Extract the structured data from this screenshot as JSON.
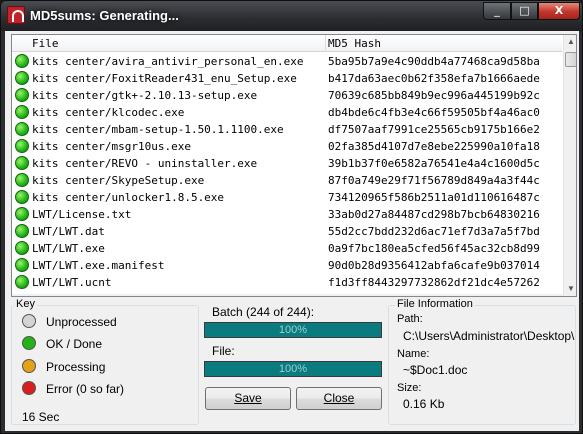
{
  "window": {
    "title": "MD5sums: Generating...",
    "min": "_",
    "max": "□",
    "close": "X"
  },
  "list": {
    "col_file": "File",
    "col_hash": "MD5 Hash",
    "rows": [
      {
        "file": "kits center/avira_antivir_personal_en.exe",
        "hash": "5ba95b7a9e4c90ddb4a77468ca9d58ba"
      },
      {
        "file": "kits center/FoxitReader431_enu_Setup.exe",
        "hash": "b417da63aec0b62f358efa7b1666aede"
      },
      {
        "file": "kits center/gtk+-2.10.13-setup.exe",
        "hash": "70639c685bb849b9ec996a445199b92c"
      },
      {
        "file": "kits center/klcodec.exe",
        "hash": "db4bde6c4fb3e4c66f59505bf4a46ac0"
      },
      {
        "file": "kits center/mbam-setup-1.50.1.1100.exe",
        "hash": "df7507aaf7991ce25565cb9175b166e2"
      },
      {
        "file": "kits center/msgr10us.exe",
        "hash": "02fa385d4107d7e8ebe225990a10fa18"
      },
      {
        "file": "kits center/REVO - uninstaller.exe",
        "hash": "39b1b37f0e6582a76541e4a4c1600d5c"
      },
      {
        "file": "kits center/SkypeSetup.exe",
        "hash": "87f0a749e29f71f56789d849a4a3f44c"
      },
      {
        "file": "kits center/unlocker1.8.5.exe",
        "hash": "734120965f586b2511a01d110616487c"
      },
      {
        "file": "LWT/License.txt",
        "hash": "33ab0d27a84487cd298b7bcb64830216"
      },
      {
        "file": "LWT/LWT.dat",
        "hash": "55d2cc7bdd232d6ac71ef7d3a7a5f7bd"
      },
      {
        "file": "LWT/LWT.exe",
        "hash": "0a9f7bc180ea5cfed56f45ac32cb8d99"
      },
      {
        "file": "LWT/LWT.exe.manifest",
        "hash": "90d0b28d9356412abfa6cafe9b037014"
      },
      {
        "file": "LWT/LWT.ucnt",
        "hash": "f1d3ff8443297732862df21dc4e57262"
      }
    ]
  },
  "key": {
    "title": "Key",
    "items": [
      {
        "label": "Unprocessed",
        "color": "#d4d4d4"
      },
      {
        "label": "OK / Done",
        "color": "#23b316"
      },
      {
        "label": "Processing",
        "color": "#e3a217"
      },
      {
        "label": "Error (0 so far)",
        "color": "#d81e1e"
      }
    ],
    "elapsed": "16 Sec"
  },
  "progress": {
    "batch_label": "Batch (244 of 244):",
    "batch_value": "100%",
    "batch_fraction": 1.0,
    "file_label": "File:",
    "file_value": "100%",
    "file_fraction": 1.0
  },
  "buttons": {
    "save": "Save",
    "close": "Close"
  },
  "info": {
    "title": "File Information",
    "path_label": "Path:",
    "path_value": "C:\\Users\\Administrator\\Desktop\\",
    "name_label": "Name:",
    "name_value": "~$Doc1.doc",
    "size_label": "Size:",
    "size_value": "0.16 Kb"
  }
}
